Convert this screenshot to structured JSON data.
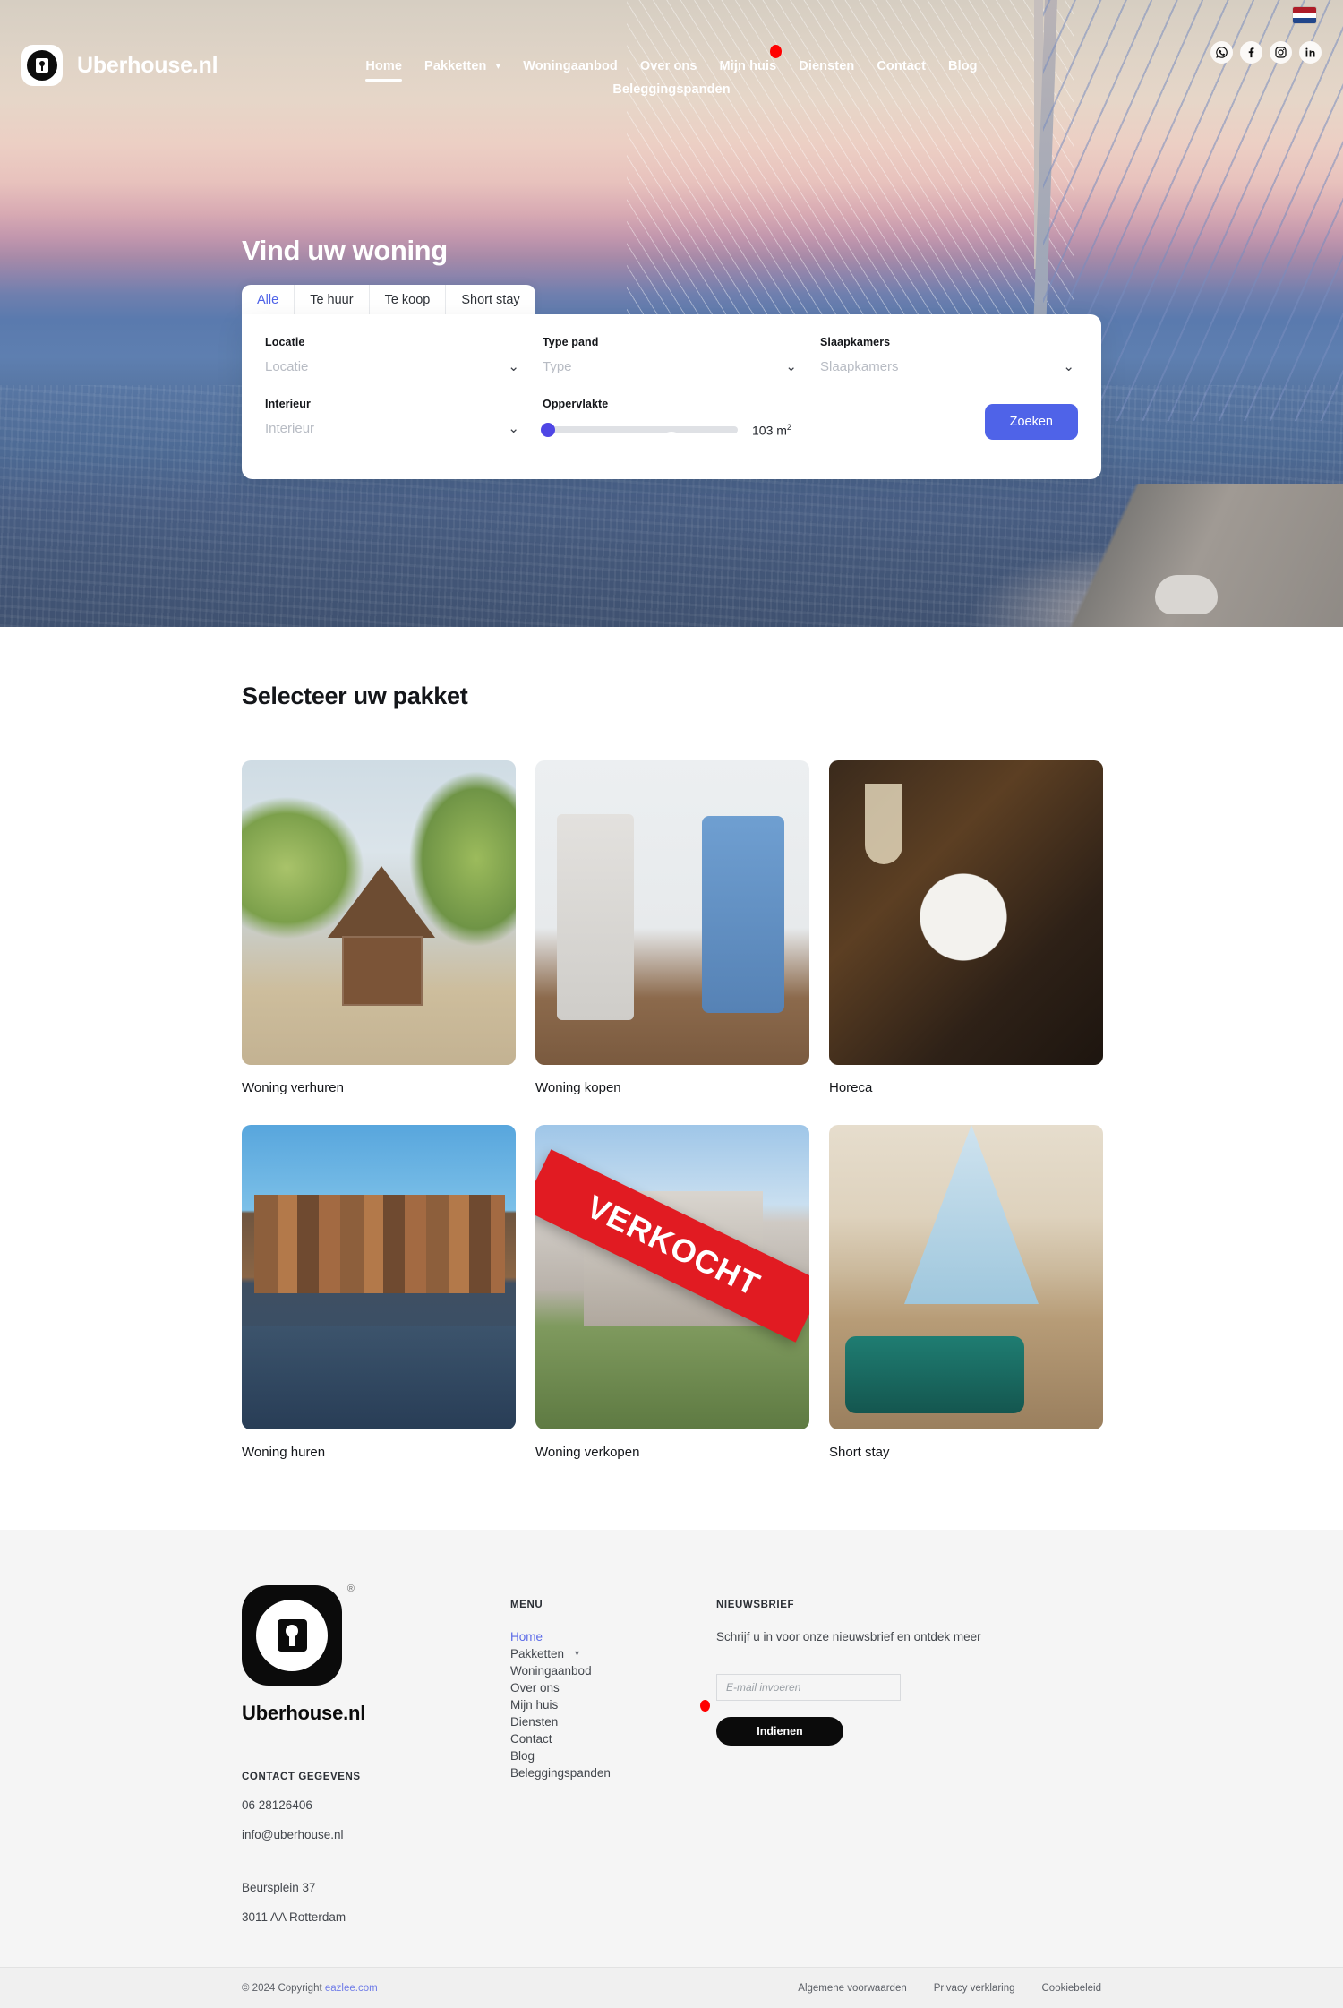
{
  "site": {
    "brand": "Uberhouse.nl",
    "logo_icon": "keyhole-lock-icon",
    "language_flag": "netherlands-flag-icon"
  },
  "header": {
    "nav_row1": [
      {
        "label": "Home",
        "active": true,
        "caret": false,
        "dot": false
      },
      {
        "label": "Pakketten",
        "active": false,
        "caret": true,
        "dot": false
      },
      {
        "label": "Woningaanbod",
        "active": false,
        "caret": false,
        "dot": false
      },
      {
        "label": "Over ons",
        "active": false,
        "caret": false,
        "dot": false
      },
      {
        "label": "Mijn huis",
        "active": false,
        "caret": false,
        "dot": true
      },
      {
        "label": "Diensten",
        "active": false,
        "caret": false,
        "dot": false
      },
      {
        "label": "Contact",
        "active": false,
        "caret": false,
        "dot": false
      },
      {
        "label": "Blog",
        "active": false,
        "caret": false,
        "dot": false
      }
    ],
    "nav_row2": [
      {
        "label": "Beleggingspanden",
        "active": false,
        "caret": false,
        "dot": false
      }
    ],
    "socials": [
      {
        "name": "whatsapp-icon"
      },
      {
        "name": "facebook-icon"
      },
      {
        "name": "instagram-icon"
      },
      {
        "name": "linkedin-icon"
      }
    ]
  },
  "hero": {
    "title": "Vind uw woning",
    "tabs": [
      {
        "label": "Alle",
        "active": true
      },
      {
        "label": "Te huur",
        "active": false
      },
      {
        "label": "Te koop",
        "active": false
      },
      {
        "label": "Short stay",
        "active": false
      }
    ],
    "search": {
      "locatie_label": "Locatie",
      "locatie_placeholder": "Locatie",
      "type_label": "Type pand",
      "type_placeholder": "Type",
      "slaapkamers_label": "Slaapkamers",
      "slaapkamers_placeholder": "Slaapkamers",
      "interieur_label": "Interieur",
      "interieur_placeholder": "Interieur",
      "oppervlakte_label": "Oppervlakte",
      "oppervlakte_value": "103 m",
      "oppervlakte_unit": "2",
      "oppervlakte_slider_percent": 3,
      "submit_label": "Zoeken",
      "accent_color": "#4f63e8"
    },
    "scroll_indicator": "scroll-mouse-icon"
  },
  "packages": {
    "title": "Selecteer uw pakket",
    "cards": [
      {
        "label": "Woning verhuren",
        "image": "cottage-house-photo"
      },
      {
        "label": "Woning kopen",
        "image": "couple-signing-contract-photo"
      },
      {
        "label": "Horeca",
        "image": "restaurant-dish-photo"
      },
      {
        "label": "Woning huren",
        "image": "amsterdam-canal-houses-photo"
      },
      {
        "label": "Woning verkopen",
        "image": "sold-house-photo",
        "badge": "VERKOCHT"
      },
      {
        "label": "Short stay",
        "image": "attic-bedroom-photo"
      }
    ]
  },
  "footer": {
    "brand": "Uberhouse.nl",
    "contact_heading": "CONTACT GEGEVENS",
    "phone": "06 28126406",
    "email": "info@uberhouse.nl",
    "address_line1": "Beursplein 37",
    "address_line2": "3011 AA Rotterdam",
    "menu_heading": "MENU",
    "menu_items": [
      {
        "label": "Home",
        "active": true,
        "caret": false
      },
      {
        "label": "Pakketten",
        "active": false,
        "caret": true
      },
      {
        "label": "Woningaanbod",
        "active": false,
        "caret": false
      },
      {
        "label": "Over ons",
        "active": false,
        "caret": false
      },
      {
        "label": "Mijn huis",
        "active": false,
        "caret": false
      },
      {
        "label": "Diensten",
        "active": false,
        "caret": false
      },
      {
        "label": "Contact",
        "active": false,
        "caret": false
      },
      {
        "label": "Blog",
        "active": false,
        "caret": false
      },
      {
        "label": "Beleggingspanden",
        "active": false,
        "caret": false
      }
    ],
    "newsletter_heading": "NIEUWSBRIEF",
    "newsletter_text": "Schrijf u in voor onze nieuwsbrief en ontdek meer",
    "newsletter_placeholder": "E-mail invoeren",
    "newsletter_button": "Indienen",
    "bottom": {
      "copyright": "© 2024 Copyright ",
      "copyright_link": "eazlee.com",
      "links": [
        "Algemene voorwaarden",
        "Privacy verklaring",
        "Cookiebeleid"
      ]
    }
  }
}
